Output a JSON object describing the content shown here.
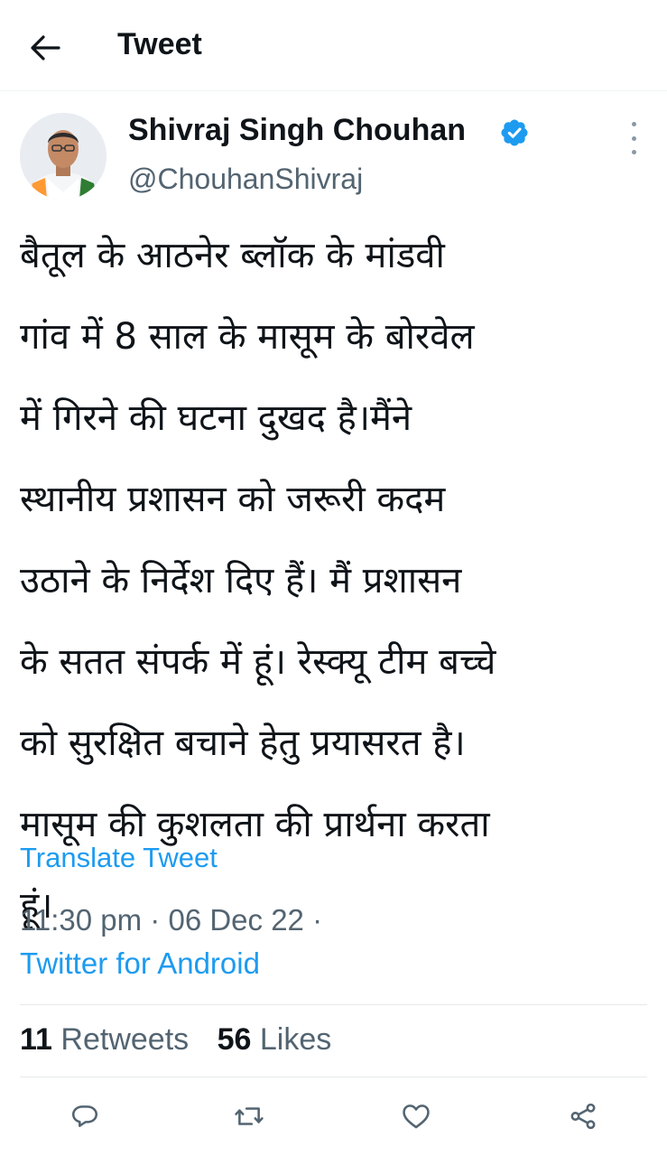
{
  "header": {
    "title": "Tweet",
    "back_icon": "arrow-left-icon"
  },
  "author": {
    "name": "Shivraj Singh Chouhan",
    "handle": "@ChouhanShivraj",
    "verified": true,
    "verified_color": "#1d9bf0"
  },
  "tweet": {
    "text": "बैतूल के आठनेर ब्लॉक के मांडवी\nगांव में 8 साल के मासूम के बोरवेल\nमें गिरने की घटना दुखद है।मैंने\nस्थानीय प्रशासन को जरूरी कदम\nउठाने के निर्देश दिए हैं। मैं प्रशासन\nके सतत संपर्क में हूं। रेस्क्यू टीम बच्चे\nको सुरक्षित बचाने हेतु प्रयासरत है।\nमासूम की कुशलता की प्रार्थना करता\nहूं।",
    "translate_label": "Translate Tweet",
    "timestamp": "11:30 pm · 06 Dec 22 ·",
    "source": "Twitter for Android"
  },
  "stats": {
    "retweets_count": "11",
    "retweets_label": "Retweets",
    "likes_count": "56",
    "likes_label": "Likes"
  },
  "actions": [
    "reply-icon",
    "retweet-icon",
    "like-icon",
    "share-icon"
  ],
  "colors": {
    "link": "#1d9bf0",
    "secondary_text": "#536471",
    "primary_text": "#0f1419"
  }
}
